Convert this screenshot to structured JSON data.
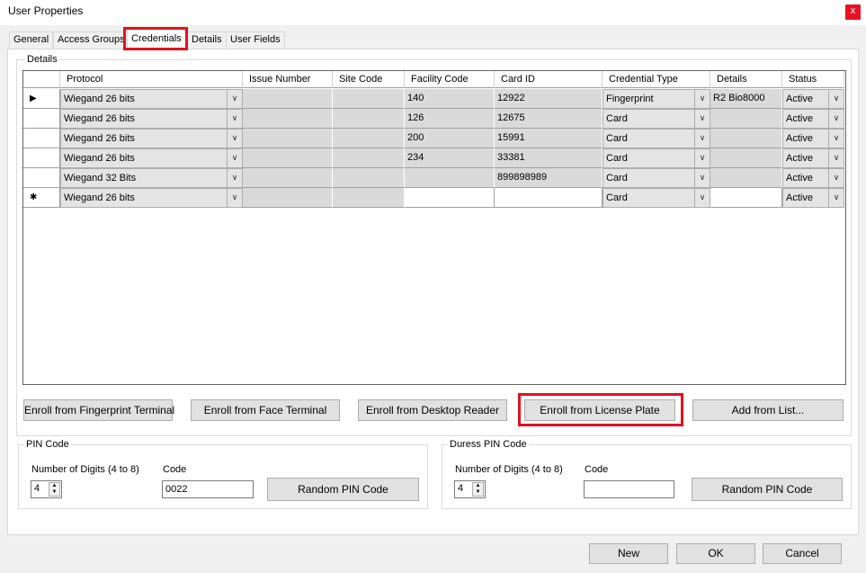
{
  "window": {
    "title": "User Properties",
    "close": "x"
  },
  "tabs": [
    "General",
    "Access Groups",
    "Credentials",
    "Details",
    "User Fields"
  ],
  "details": {
    "legend": "Details",
    "columns": [
      "Protocol",
      "Issue Number",
      "Site Code",
      "Facility Code",
      "Card ID",
      "Credential Type",
      "Details",
      "Status"
    ],
    "rows": [
      {
        "marker": "▶",
        "protocol": "Wiegand 26 bits",
        "issue": "",
        "site": "",
        "facility": "140",
        "card": "12922",
        "type": "Fingerprint",
        "details": "R2   Bio8000",
        "status": "Active"
      },
      {
        "marker": "",
        "protocol": "Wiegand 26 bits",
        "issue": "",
        "site": "",
        "facility": "126",
        "card": "12675",
        "type": "Card",
        "details": "",
        "status": "Active"
      },
      {
        "marker": "",
        "protocol": "Wiegand 26 bits",
        "issue": "",
        "site": "",
        "facility": "200",
        "card": "15991",
        "type": "Card",
        "details": "",
        "status": "Active"
      },
      {
        "marker": "",
        "protocol": "Wiegand 26 bits",
        "issue": "",
        "site": "",
        "facility": "234",
        "card": "33381",
        "type": "Card",
        "details": "",
        "status": "Active"
      },
      {
        "marker": "",
        "protocol": "Wiegand 32 Bits",
        "issue": "",
        "site": "",
        "facility": "",
        "card": "899898989",
        "type": "Card",
        "details": "",
        "status": "Active"
      },
      {
        "marker": "✱",
        "protocol": "Wiegand 26 bits",
        "issue": "",
        "site": "",
        "facility": "",
        "card": "",
        "type": "Card",
        "details": "",
        "status": "Active"
      }
    ]
  },
  "buttons": {
    "enroll_fingerprint": "Enroll from Fingerprint Terminal",
    "enroll_face": "Enroll from Face Terminal",
    "enroll_desktop": "Enroll from Desktop Reader",
    "enroll_plate": "Enroll from License Plate",
    "add_list": "Add from List..."
  },
  "pin": {
    "legend": "PIN Code",
    "digits_label": "Number of Digits (4 to 8)",
    "digits": "4",
    "code_label": "Code",
    "code": "0022",
    "random": "Random PIN Code"
  },
  "duress": {
    "legend": "Duress PIN Code",
    "digits_label": "Number of Digits (4 to 8)",
    "digits": "4",
    "code_label": "Code",
    "code": "",
    "random": "Random PIN Code"
  },
  "footer": {
    "new": "New",
    "ok": "OK",
    "cancel": "Cancel"
  },
  "colors": {
    "highlight": "#e3101f",
    "close": "#e81123"
  }
}
